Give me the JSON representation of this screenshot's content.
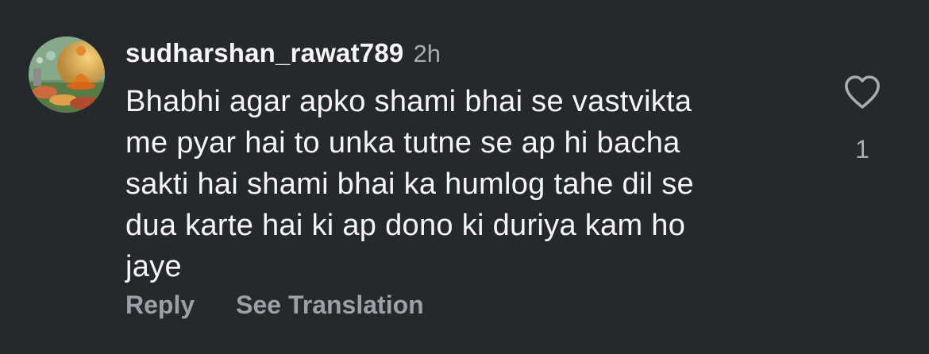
{
  "comment": {
    "username": "sudharshan_rawat789",
    "timestamp": "2h",
    "text_lines": [
      "Bhabhi agar apko shami bhai se vastvikta",
      "me pyar hai to unka tutne se ap hi bacha",
      "sakti hai shami bhai ka humlog tahe dil se",
      "dua karte hai ki ap dono ki duriya kam ho",
      "jaye"
    ],
    "like_count": "1",
    "like_icon": "heart-outline-icon"
  },
  "actions": {
    "reply_label": "Reply",
    "translate_label": "See Translation"
  },
  "colors": {
    "background": "#25282c",
    "primary_text": "#f5f5f5",
    "secondary_text": "#a8acb3",
    "action_text": "#9ca0a7"
  }
}
